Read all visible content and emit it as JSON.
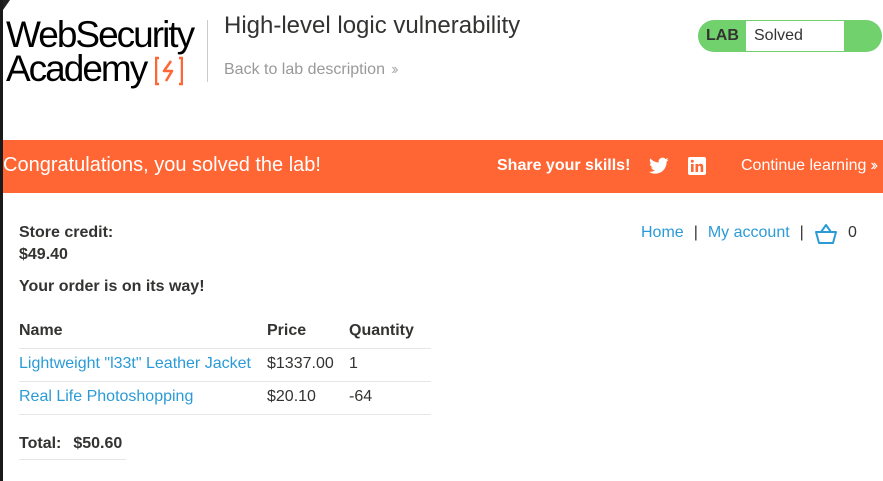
{
  "header": {
    "logo_line1": "WebSecurity",
    "logo_line2": "Academy",
    "lab_title": "High-level logic vulnerability",
    "back_link": "Back to lab description",
    "lab_tag": "LAB",
    "lab_status": "Solved"
  },
  "banner": {
    "message": "Congratulations, you solved the lab!",
    "share_label": "Share your skills!",
    "continue_link": "Continue learning"
  },
  "nav": {
    "home": "Home",
    "separator": "|",
    "account": "My account",
    "cart_count": "0"
  },
  "store": {
    "credit_label": "Store credit:",
    "credit_value": "$49.40",
    "order_message": "Your order is on its way!"
  },
  "order_table": {
    "headers": [
      "Name",
      "Price",
      "Quantity"
    ],
    "rows": [
      {
        "name": "Lightweight \"l33t\" Leather Jacket",
        "price": "$1337.00",
        "quantity": "1"
      },
      {
        "name": "Real Life Photoshopping",
        "price": "$20.10",
        "quantity": "-64"
      }
    ]
  },
  "total": {
    "label": "Total:",
    "value": "$50.60"
  },
  "colors": {
    "accent_orange": "#ff6633",
    "solved_green": "#70d16d",
    "link_blue": "#2b9bd6"
  }
}
